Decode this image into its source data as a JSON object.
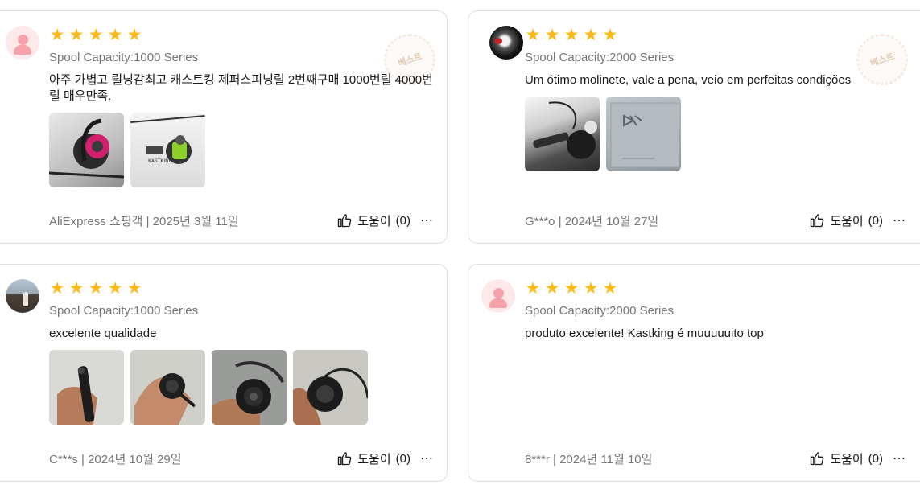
{
  "colors": {
    "star": "#ffb916",
    "meta_text": "#757575",
    "border": "#dddddd",
    "avatar_default_bg": "#fde8ea",
    "avatar_default_fg": "#f7a1aa"
  },
  "reviews": [
    {
      "avatar": "default-avatar-icon",
      "rating": 5,
      "sku": "Spool Capacity:1000 Series",
      "text": "아주 가볍고 릴닝감최고 캐스트킹 제퍼스피닝릴 2번째구매 1000번릴 4000번릴 매우만족.",
      "image_count": 2,
      "meta": "AliExpress 쇼핑객 | 2025년 3월 11일",
      "helpful_label": "도움이",
      "helpful_count": "(0)",
      "more": "⋯",
      "badge": "베스트"
    },
    {
      "avatar": "user-photo",
      "rating": 5,
      "sku": "Spool Capacity:2000 Series",
      "text": "Um ótimo molinete, vale a pena, veio em perfeitas condições",
      "image_count": 2,
      "meta": "G***o | 2024년 10월 27일",
      "helpful_label": "도움이",
      "helpful_count": "(0)",
      "more": "⋯",
      "badge": "베스트"
    },
    {
      "avatar": "user-photo",
      "rating": 5,
      "sku": "Spool Capacity:1000 Series",
      "text": "excelente qualidade",
      "image_count": 4,
      "meta": "C***s | 2024년 10월 29일",
      "helpful_label": "도움이",
      "helpful_count": "(0)",
      "more": "⋯"
    },
    {
      "avatar": "default-avatar-icon",
      "rating": 5,
      "sku": "Spool Capacity:2000 Series",
      "text": "produto excelente! Kastking é muuuuuito top",
      "image_count": 0,
      "meta": "8***r | 2024년 11월 10일",
      "helpful_label": "도움이",
      "helpful_count": "(0)",
      "more": "⋯"
    }
  ]
}
